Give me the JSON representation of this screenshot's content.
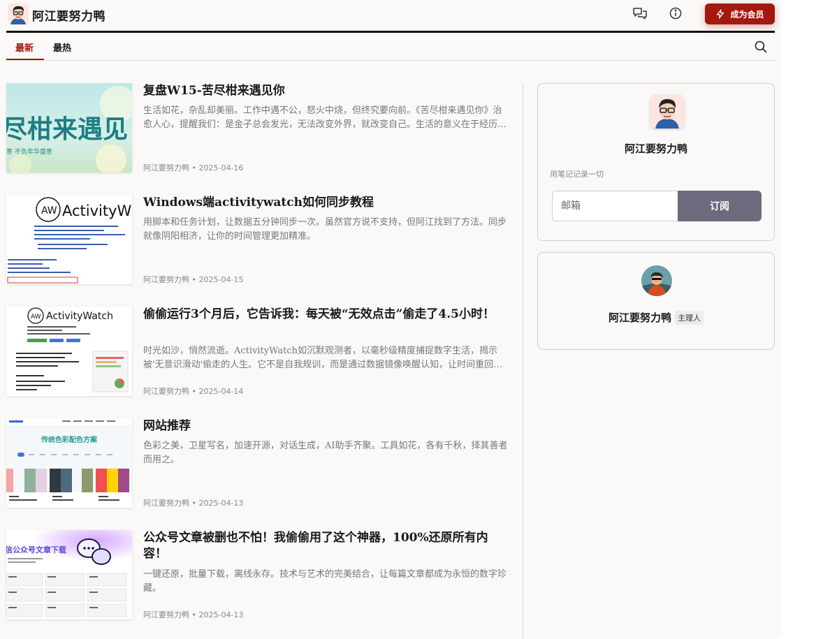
{
  "site": {
    "title": "阿江要努力鸭",
    "member_button": "成为会员"
  },
  "header": {
    "icons": [
      "chat-icon",
      "info-icon",
      "bolt-icon"
    ]
  },
  "tabs": [
    {
      "label": "最新",
      "active": true
    },
    {
      "label": "最热",
      "active": false
    }
  ],
  "posts": [
    {
      "title": "复盘W15-苦尽柑来遇见你",
      "excerpt": "生活如花，杂乱却美丽。工作中遇不公，怒火中烧，但终究要向前。《苦尽柑来遇见你》治愈人心，提醒我们：是金子总会发光，无法改变外界，就改变自己。生活的意义在于经历，在于成长。",
      "author": "阿江要努力鸭",
      "date": "2025-04-16",
      "thumb_text": "尽柑来遇见",
      "thumb_sub": "意 不负年华盛意"
    },
    {
      "title": "Windows端activitywatch如何同步教程",
      "excerpt": "用脚本和任务计划，让数据五分钟同步一次。虽然官方说不支持，但阿江找到了方法。同步就像阴阳相济，让你的时间管理更加精准。",
      "author": "阿江要努力鸭",
      "date": "2025-04-15",
      "thumb_text": "ActivityW",
      "thumb_logo": "AW"
    },
    {
      "title": "偷偷运行3个月后，它告诉我：每天被“无效点击”偷走了4.5小时！",
      "excerpt": "时光如沙，悄然流逝。ActivityWatch如沉默观测者，以毫秒级精度捕捉数字生活，揭示被'无意识滑动'偷走的人生。它不是自我规训，而是通过数据镜像唤醒认知，让时间重回掌控。",
      "author": "阿江要努力鸭",
      "date": "2025-04-14",
      "thumb_text": "ActivityWatch",
      "thumb_logo": "AW"
    },
    {
      "title": "网站推荐",
      "excerpt": "色彩之美，卫星写名，加速开源，对话生成，AI助手齐聚。工具如花，各有千秋，择其善者而用之。",
      "author": "阿江要努力鸭",
      "date": "2025-04-13",
      "thumb_text": "传统色彩配色方案"
    },
    {
      "title": "公众号文章被删也不怕！我偷偷用了这个神器，100%还原所有内容！",
      "excerpt": "一键还原，批量下载，离线永存。技术与艺术的完美结合，让每篇文章都成为永恒的数字珍藏。",
      "author": "阿江要努力鸭",
      "date": "2025-04-13",
      "thumb_text": "信公众号文章下载"
    }
  ],
  "sidebar": {
    "profile": {
      "name": "阿江要努力鸭",
      "tagline": "用笔记记录一切",
      "email_placeholder": "邮箱",
      "subscribe_label": "订阅"
    },
    "owner": {
      "name": "阿江要努力鸭",
      "role": "主理人"
    }
  },
  "colors": {
    "accent": "#a3190f",
    "subscribe": "#6c6a7c",
    "background": "#faf9f7"
  }
}
